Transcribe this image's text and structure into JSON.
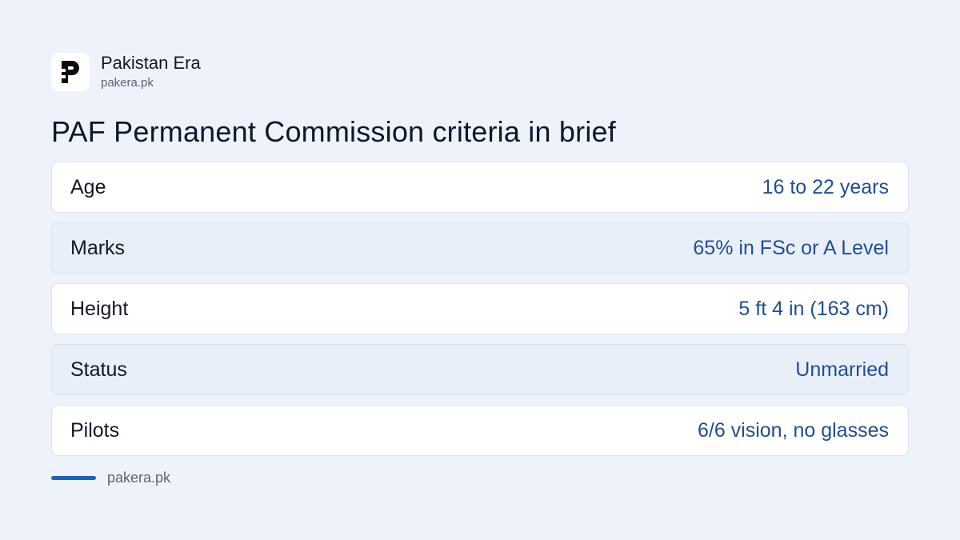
{
  "brand": {
    "name": "Pakistan Era",
    "url": "pakera.pk",
    "logo_icon": "pakera-logo-icon"
  },
  "title": "PAF Permanent Commission criteria in brief",
  "criteria": [
    {
      "label": "Age",
      "value": "16 to 22 years"
    },
    {
      "label": "Marks",
      "value": "65% in FSc or A Level"
    },
    {
      "label": "Height",
      "value": "5 ft 4 in (163 cm)"
    },
    {
      "label": "Status",
      "value": "Unmarried"
    },
    {
      "label": "Pilots",
      "value": "6/6 vision, no glasses"
    }
  ],
  "footer": {
    "text": "pakera.pk"
  },
  "colors": {
    "background": "#eef3fb",
    "accent": "#1f5fbf",
    "value_text": "#1f4e94"
  }
}
